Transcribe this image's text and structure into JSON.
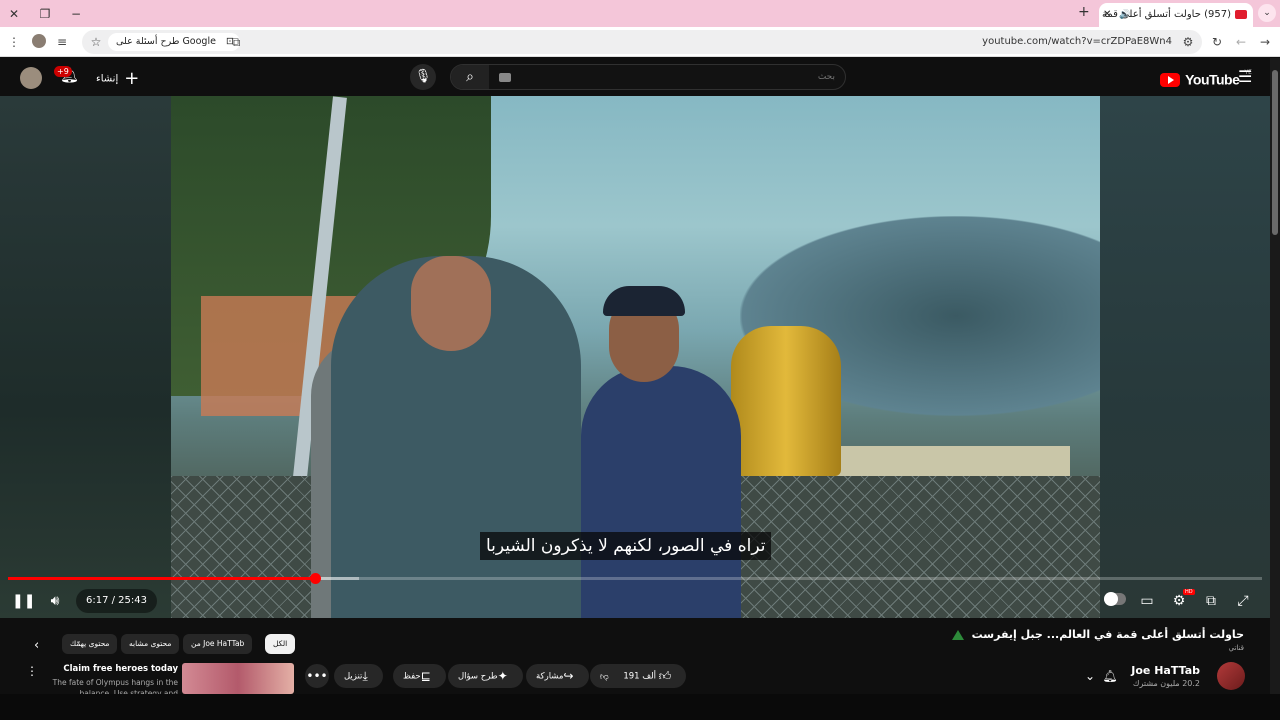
{
  "browser": {
    "tab_title": "(957) حاولت أتسلق أعلى قمة",
    "url": "youtube.com/watch?v=crZDPaE8Wn4",
    "ask_google_label": "طرح أسئلة على Google",
    "new_tab_icon": "plus-icon"
  },
  "header": {
    "notification_count": "+9",
    "create_label": "إنشاء",
    "search_placeholder": "بحث",
    "logo_text": "YouTube",
    "country_code": "YE"
  },
  "player": {
    "subtitle": "تراه في الصور، لكنهم لا يذكرون الشيربا",
    "time": "6:17 / 25:43",
    "progress_fraction": 0.245,
    "buffered_fraction": 0.28,
    "hd_badge": "HD"
  },
  "video": {
    "title": "حاولت أتسلق أعلى قمة في العالم... جبل إيفرست",
    "tagline": "قناتي",
    "channel_name": "Joe HaTTab",
    "subscribers": "20.2 مليون مشترك",
    "likes": "191 ألف",
    "share_label": "مشاركة",
    "ask_label": "طرح سؤال",
    "save_label": "حفظ",
    "download_label": "تنزيل"
  },
  "chips": {
    "all": "الكل",
    "from_channel": "من Joe HaTTab",
    "similar": "محتوى مشابه",
    "for_you": "محتوى يهمّك"
  },
  "ad": {
    "title": "Claim free heroes today",
    "description": "The fate of Olympus hangs in the balance. Use strategy and positioning"
  },
  "colors": {
    "accent": "#ff0000",
    "tabbar": "#f4c6d9",
    "background": "#0f0f0f"
  }
}
